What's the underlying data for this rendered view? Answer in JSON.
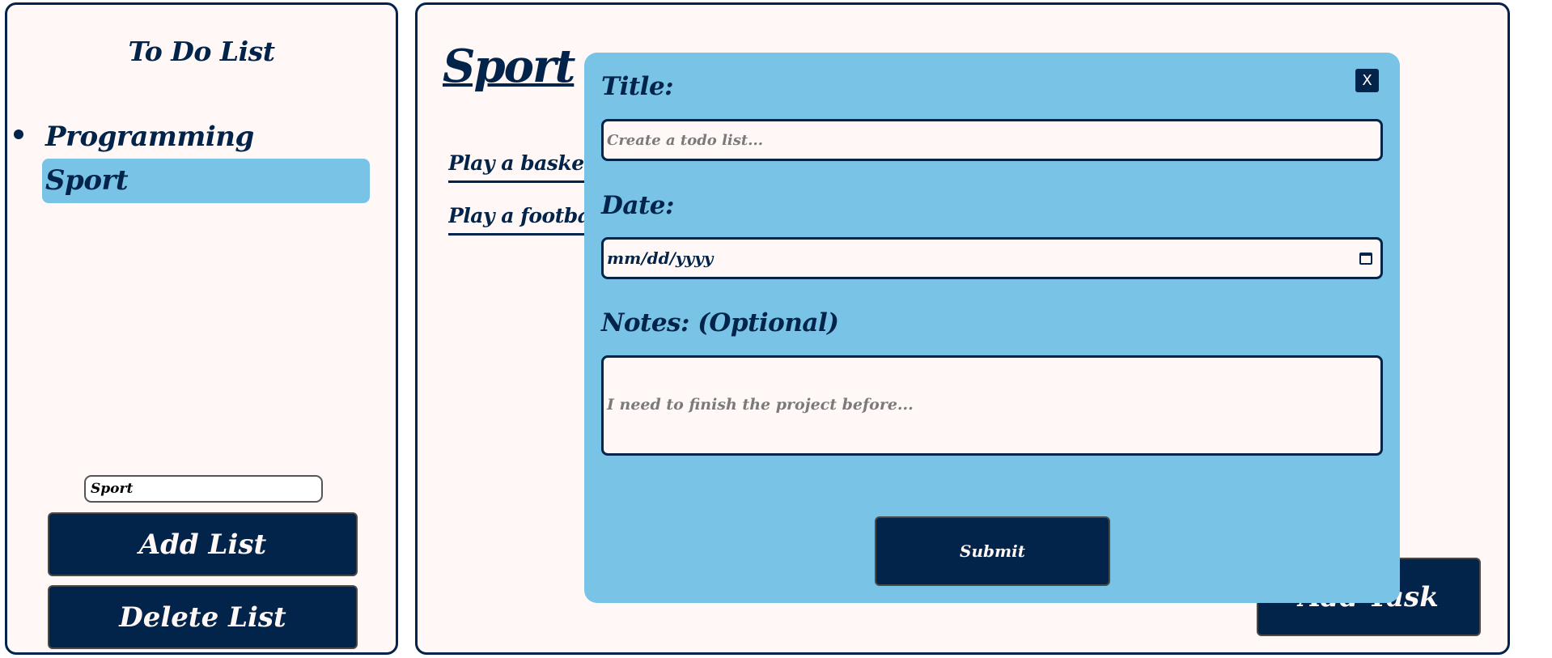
{
  "sidebar": {
    "title": "To Do List",
    "lists": [
      {
        "label": "Programming",
        "selected": false
      },
      {
        "label": "Sport",
        "selected": true
      }
    ],
    "new_list_input_value": "Sport",
    "add_list_label": "Add List",
    "delete_list_label": "Delete List"
  },
  "main": {
    "list_title": "Sport",
    "tasks": [
      {
        "label": "Play a basketball game"
      },
      {
        "label": "Play a football game"
      }
    ],
    "add_task_label": "Add Task"
  },
  "modal": {
    "close_label": "X",
    "title_label": "Title:",
    "title_placeholder": "Create a todo list...",
    "date_label": "Date:",
    "date_placeholder": "mm/dd/yyyy",
    "notes_label": "Notes: (Optional)",
    "notes_placeholder": "I need to finish the project before...",
    "submit_label": "Submit"
  },
  "colors": {
    "navy": "#02244a",
    "accent": "#79c3e6",
    "panel_bg": "#fff8f6"
  }
}
